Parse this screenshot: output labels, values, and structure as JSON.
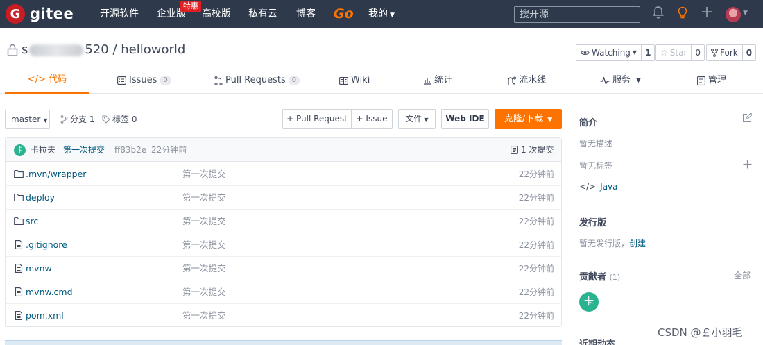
{
  "topnav": {
    "logo_mark": "G",
    "logo_text": "gitee",
    "items": [
      "开源软件",
      "企业版",
      "高校版",
      "私有云",
      "博客"
    ],
    "go": "Go",
    "mine": "我的",
    "special_badge": "特惠",
    "search_placeholder": "搜开源"
  },
  "project": {
    "owner_visible": "520",
    "owner_prefix": "s",
    "name": "helloworld",
    "separator": " / ",
    "watching_label": "Watching",
    "watching_count": "1",
    "star_label": "Star",
    "star_count": "0",
    "fork_label": "Fork",
    "fork_count": "0"
  },
  "tabs": [
    {
      "label": "代码",
      "badge": ""
    },
    {
      "label": "Issues",
      "badge": "0"
    },
    {
      "label": "Pull Requests",
      "badge": "0"
    },
    {
      "label": "Wiki",
      "badge": ""
    },
    {
      "label": "统计",
      "badge": ""
    },
    {
      "label": "流水线",
      "badge": ""
    },
    {
      "label": "服务",
      "badge": ""
    },
    {
      "label": "管理",
      "badge": ""
    }
  ],
  "toolbar": {
    "branch": "master",
    "branches": "分支 1",
    "tags": "标签 0",
    "pull_request": "+ Pull Request",
    "issue": "+ Issue",
    "file": "文件",
    "web_ide": "Web IDE",
    "clone": "克隆/下载"
  },
  "commit": {
    "avatar": "卡",
    "author": "卡拉夫",
    "message": "第一次提交",
    "hash": "ff83b2e",
    "time": "22分钟前",
    "count": "1 次提交"
  },
  "files": [
    {
      "name": ".mvn/wrapper",
      "type": "folder",
      "msg": "第一次提交",
      "time": "22分钟前"
    },
    {
      "name": "deploy",
      "type": "folder",
      "msg": "第一次提交",
      "time": "22分钟前"
    },
    {
      "name": "src",
      "type": "folder",
      "msg": "第一次提交",
      "time": "22分钟前"
    },
    {
      "name": ".gitignore",
      "type": "file",
      "msg": "第一次提交",
      "time": "22分钟前"
    },
    {
      "name": "mvnw",
      "type": "file",
      "msg": "第一次提交",
      "time": "22分钟前"
    },
    {
      "name": "mvnw.cmd",
      "type": "file",
      "msg": "第一次提交",
      "time": "22分钟前"
    },
    {
      "name": "pom.xml",
      "type": "file",
      "msg": "第一次提交",
      "time": "22分钟前"
    }
  ],
  "sidebar": {
    "intro_title": "简介",
    "no_desc": "暂无描述",
    "no_tags": "暂无标签",
    "language": "Java",
    "release_title": "发行版",
    "no_release": "暂无发行版，",
    "create": "创建",
    "contributors_title": "贡献者",
    "contributors_count": "(1)",
    "all": "全部",
    "contributor_avatar": "卡",
    "activity_title": "近期动态"
  },
  "watermark": "CSDN @￡小羽毛",
  "colors": {
    "brand": "#c71d23",
    "accent": "#fe7300",
    "nav_bg": "#2e3a4b",
    "link": "#005980"
  }
}
